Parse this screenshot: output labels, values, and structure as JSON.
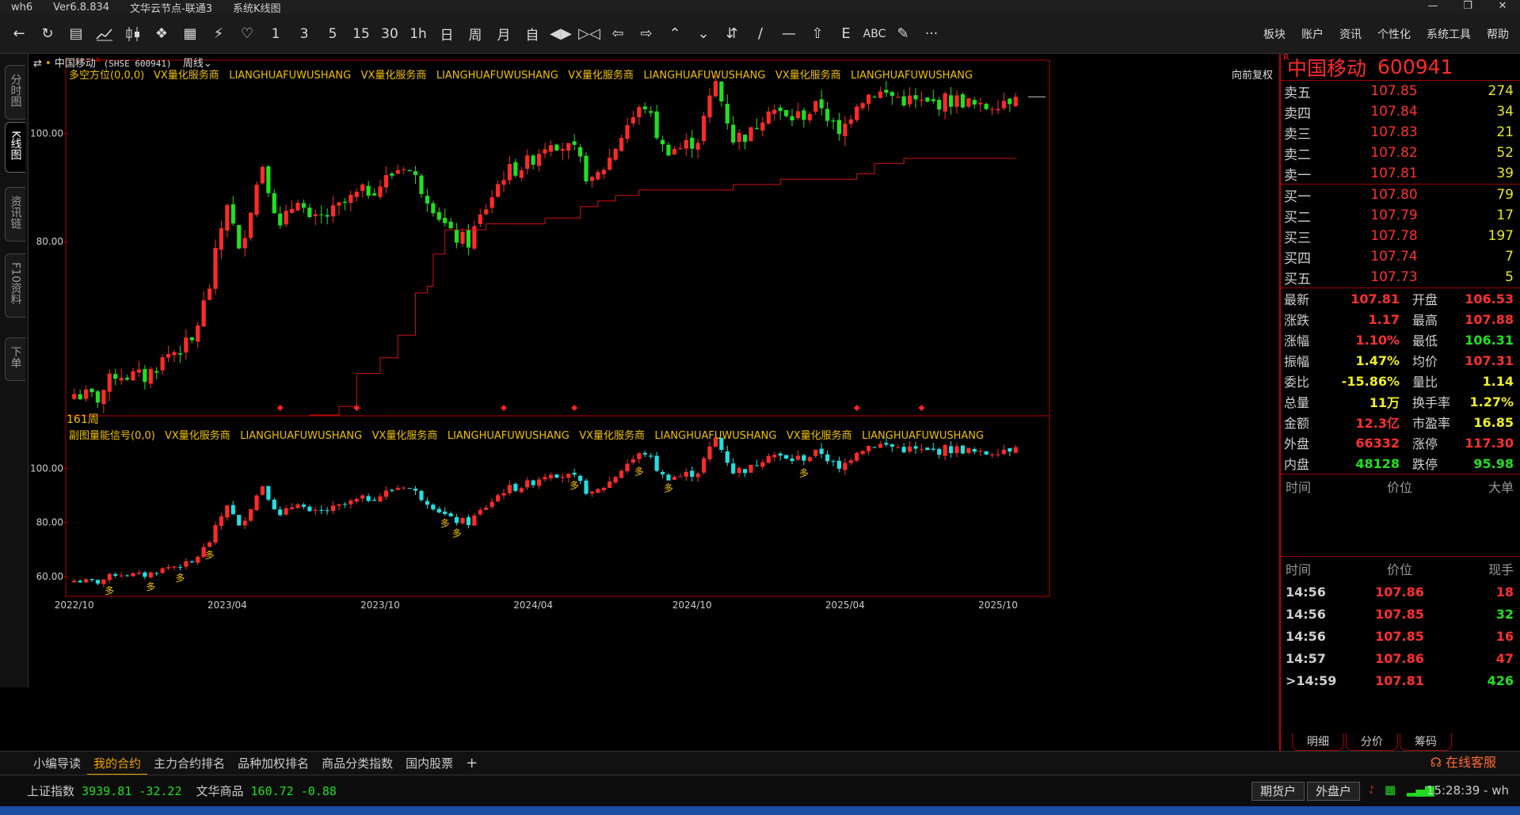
{
  "window": {
    "app": "wh6",
    "version": "Ver6.8.834",
    "node": "文华云节点-联通3",
    "view": "系统K线图",
    "controls": [
      "—",
      "❐",
      "✕"
    ]
  },
  "toolbar": {
    "icons": [
      "back-icon",
      "refresh-icon",
      "list-icon",
      "line-chart-icon",
      "candle-icon",
      "indicator-icon",
      "f10-icon",
      "lightning-icon",
      "bell-icon"
    ],
    "periods": [
      "1",
      "3",
      "5",
      "15",
      "30",
      "1h",
      "日",
      "周",
      "月",
      "自"
    ],
    "tools_icons": [
      "zoom-in-icon",
      "zoom-out-icon",
      "left-arrow-icon",
      "right-arrow-icon",
      "up-arrows-icon",
      "down-arrows-icon",
      "crosshair-icon",
      "draw-line-icon",
      "hline-icon",
      "home-icon",
      "e-icon"
    ],
    "abc": "ABC",
    "more": "···"
  },
  "menu": [
    "板块",
    "账户",
    "资讯",
    "个性化",
    "系统工具",
    "帮助"
  ],
  "left_tabs": [
    {
      "label": "分时图",
      "active": false
    },
    {
      "label": "K线图",
      "active": true
    },
    {
      "label": "资讯链",
      "active": false
    },
    {
      "label": "F10资料",
      "active": false
    },
    {
      "label": "下单",
      "active": false
    }
  ],
  "chart_header": {
    "symbol": "中国移动",
    "symbol_code": "(SHSE 600941)",
    "period": "周线",
    "main_indicator": "多空方位(0,0,0)",
    "watermark": "VX量化服务商   LIANGHUAFUWUSHANG   VX量化服务商   LIANGHUAFUWUSHANG   VX量化服务商   LIANGHUAFUWUSHANG   VX量化服务商   LIANGHUAFUWUSHANG",
    "adjust": "向前复权",
    "bar_count": "161周",
    "sub_indicator": "副图量能信号(0,0)",
    "sub_watermark": "VX量化服务商   LIANGHUAFUWUSHANG   VX量化服务商   LIANGHUAFUWUSHANG   VX量化服务商   LIANGHUAFUWUSHANG   VX量化服务商   LIANGHUAFUWUSHANG",
    "signal_label": "多"
  },
  "chart_data": [
    {
      "type": "candlestick",
      "panel": "main",
      "y_ticks": [
        "100.00",
        "80.00"
      ],
      "ylim": [
        56,
        114
      ],
      "scale": "log",
      "x_ticks": [
        "2022/10",
        "2023/04",
        "2023/10",
        "2024/04",
        "2024/10",
        "2025/04",
        "2025/10"
      ],
      "close_knots": [
        [
          0,
          58.5
        ],
        [
          4,
          58
        ],
        [
          7,
          61
        ],
        [
          12,
          60.5
        ],
        [
          16,
          63.5
        ],
        [
          20,
          65
        ],
        [
          23,
          73
        ],
        [
          26,
          87
        ],
        [
          28,
          78
        ],
        [
          30,
          86
        ],
        [
          32,
          94
        ],
        [
          35,
          82
        ],
        [
          38,
          88
        ],
        [
          40,
          83
        ],
        [
          44,
          85
        ],
        [
          48,
          88
        ],
        [
          52,
          90
        ],
        [
          56,
          94
        ],
        [
          60,
          88
        ],
        [
          64,
          81
        ],
        [
          67,
          80
        ],
        [
          70,
          86
        ],
        [
          73,
          92
        ],
        [
          77,
          94
        ],
        [
          81,
          99
        ],
        [
          85,
          96
        ],
        [
          88,
          90
        ],
        [
          91,
          95
        ],
        [
          94,
          102
        ],
        [
          97,
          106
        ],
        [
          100,
          97
        ],
        [
          103,
          97
        ],
        [
          106,
          99
        ],
        [
          109,
          111
        ],
        [
          112,
          99
        ],
        [
          115,
          100
        ],
        [
          118,
          106
        ],
        [
          121,
          103
        ],
        [
          124,
          104
        ],
        [
          127,
          106
        ],
        [
          130,
          99
        ],
        [
          133,
          107
        ],
        [
          136,
          109
        ],
        [
          139,
          108
        ],
        [
          142,
          107
        ],
        [
          145,
          106
        ],
        [
          148,
          107
        ],
        [
          151,
          107
        ],
        [
          154,
          105
        ],
        [
          157,
          107
        ],
        [
          160,
          107.81
        ]
      ],
      "trend_line_steps": [
        [
          40,
          56
        ],
        [
          45,
          57
        ],
        [
          48,
          61
        ],
        [
          52,
          63
        ],
        [
          55,
          66
        ],
        [
          58,
          72
        ],
        [
          60,
          73
        ],
        [
          61,
          78
        ],
        [
          63,
          82
        ],
        [
          70,
          83
        ],
        [
          80,
          84
        ],
        [
          86,
          86
        ],
        [
          89,
          87
        ],
        [
          92,
          88
        ],
        [
          96,
          89
        ],
        [
          106,
          89
        ],
        [
          112,
          90
        ],
        [
          120,
          91
        ],
        [
          133,
          92
        ],
        [
          136,
          94
        ],
        [
          141,
          95
        ]
      ],
      "signal_markers_x": [
        35,
        48,
        73,
        85,
        133,
        144
      ],
      "up_color": "#ff2a2a",
      "down_color": "#20e020",
      "trend_color": "#d01010"
    },
    {
      "type": "candlestick",
      "panel": "sub",
      "y_ticks": [
        "100.00",
        "80.00",
        "60.00"
      ],
      "ylim": [
        53,
        115
      ],
      "up_color": "#ff2a2a",
      "down_color": "#20e0e0",
      "signal_x": [
        6,
        13,
        18,
        23,
        63,
        65,
        85,
        96,
        101,
        124
      ]
    }
  ],
  "quote": {
    "name": "中国移动",
    "code": "600941",
    "asks": [
      {
        "label": "卖五",
        "price": "107.85",
        "vol": "274"
      },
      {
        "label": "卖四",
        "price": "107.84",
        "vol": "34"
      },
      {
        "label": "卖三",
        "price": "107.83",
        "vol": "21"
      },
      {
        "label": "卖二",
        "price": "107.82",
        "vol": "52"
      },
      {
        "label": "卖一",
        "price": "107.81",
        "vol": "39"
      }
    ],
    "bids": [
      {
        "label": "买一",
        "price": "107.80",
        "vol": "79"
      },
      {
        "label": "买二",
        "price": "107.79",
        "vol": "17"
      },
      {
        "label": "买三",
        "price": "107.78",
        "vol": "197"
      },
      {
        "label": "买四",
        "price": "107.74",
        "vol": "7"
      },
      {
        "label": "买五",
        "price": "107.73",
        "vol": "5"
      }
    ],
    "stats": [
      {
        "k": "最新",
        "v": "107.81",
        "vc": "red",
        "k2": "开盘",
        "v2": "106.53",
        "v2c": "red"
      },
      {
        "k": "涨跌",
        "v": "1.17",
        "vc": "red",
        "k2": "最高",
        "v2": "107.88",
        "v2c": "red"
      },
      {
        "k": "涨幅",
        "v": "1.10%",
        "vc": "red",
        "k2": "最低",
        "v2": "106.31",
        "v2c": "green"
      },
      {
        "k": "振幅",
        "v": "1.47%",
        "vc": "yellow",
        "k2": "均价",
        "v2": "107.31",
        "v2c": "red"
      },
      {
        "k": "委比",
        "v": "-15.86%",
        "vc": "yellow",
        "k2": "量比",
        "v2": "1.14",
        "v2c": "yellow"
      },
      {
        "k": "总量",
        "v": "11万",
        "vc": "yellow",
        "k2": "换手率",
        "v2": "1.27%",
        "v2c": "yellow"
      },
      {
        "k": "金额",
        "v": "12.3亿",
        "vc": "red",
        "k2": "市盈率",
        "v2": "16.85",
        "v2c": "yellow"
      },
      {
        "k": "外盘",
        "v": "66332",
        "vc": "red",
        "k2": "涨停",
        "v2": "117.30",
        "v2c": "red"
      },
      {
        "k": "内盘",
        "v": "48128",
        "vc": "green",
        "k2": "跌停",
        "v2": "95.98",
        "v2c": "green"
      }
    ],
    "big_header": [
      "时间",
      "价位",
      "大单"
    ],
    "tick_header": [
      "时间",
      "价位",
      "现手"
    ],
    "ticks": [
      {
        "t": "14:56",
        "p": "107.86",
        "q": "18",
        "qc": "red"
      },
      {
        "t": "14:56",
        "p": "107.85",
        "q": "32",
        "qc": "green"
      },
      {
        "t": "14:56",
        "p": "107.85",
        "q": "16",
        "qc": "red"
      },
      {
        "t": "14:57",
        "p": "107.86",
        "q": "47",
        "qc": "red"
      },
      {
        "t": ">14:59",
        "p": "107.81",
        "q": "426",
        "qc": "green"
      }
    ],
    "tabs": [
      "明细",
      "分价",
      "筹码"
    ]
  },
  "bottom_tabs": [
    {
      "label": "小编导读",
      "active": false
    },
    {
      "label": "我的合约",
      "active": true
    },
    {
      "label": "主力合约排名",
      "active": false
    },
    {
      "label": "品种加权排名",
      "active": false
    },
    {
      "label": "商品分类指数",
      "active": false
    },
    {
      "label": "国内股票",
      "active": false
    },
    {
      "label": "+",
      "active": false
    }
  ],
  "support": "在线客服",
  "status": {
    "idx1_name": "上证指数",
    "idx1_val": "3939.81",
    "idx1_chg": "-32.22",
    "idx2_name": "文华商品",
    "idx2_val": "160.72",
    "idx2_chg": "-0.88",
    "btn1": "期货户",
    "btn2": "外盘户",
    "clock": "15:28:39 - wh"
  }
}
